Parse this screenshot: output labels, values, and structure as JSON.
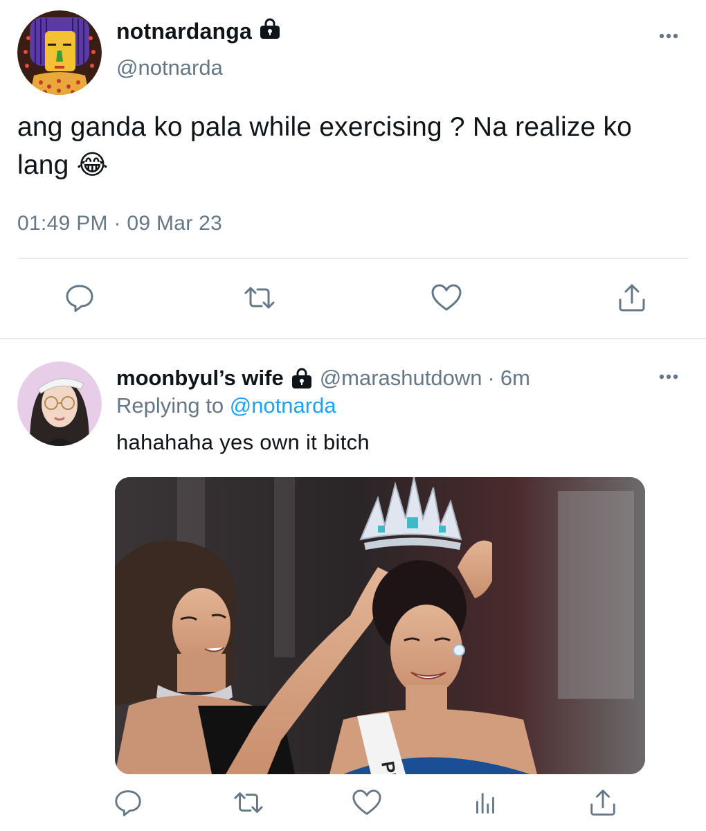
{
  "main_tweet": {
    "display_name": "notnardanga",
    "handle": "@notnarda",
    "text": "ang ganda ko pala while exercising ? Na realize ko lang 😂",
    "timestamp": "01:49 PM · 09 Mar 23",
    "protected_icon": "lock-icon",
    "actions": [
      "reply-icon",
      "retweet-icon",
      "like-icon",
      "share-icon"
    ]
  },
  "reply_tweet": {
    "display_name": "moonbyul’s wife",
    "handle": "@marashutdown",
    "separator": "·",
    "time_ago": "6m",
    "replying_label": "Replying to",
    "replying_to": "@notnarda",
    "text": "hahahaha yes own it bitch",
    "media_sash_text": "PHI",
    "protected_icon": "lock-icon",
    "actions": [
      "reply-icon",
      "retweet-icon",
      "like-icon",
      "analytics-icon",
      "share-icon"
    ]
  },
  "colors": {
    "text_primary": "#0f1419",
    "text_secondary": "#657786",
    "link": "#1da1f2",
    "divider": "#e6ecf0"
  }
}
